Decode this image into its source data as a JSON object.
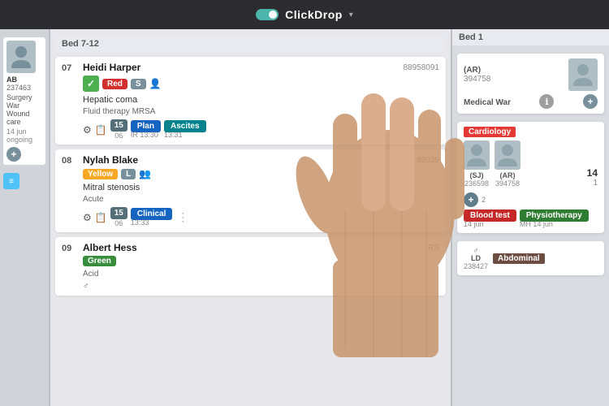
{
  "app": {
    "title": "ClickDrop",
    "dropdown_arrow": "▾"
  },
  "bed_header_main": "Bed 7-12",
  "bed_header_right": "Bed 1",
  "patients": [
    {
      "bed": "07",
      "name": "Heidi Harper",
      "id": "88958091",
      "tag_color": "Red",
      "tag_size": "S",
      "diagnosis": "Hepatic coma",
      "sub_info": "Fluid therapy  MRSA",
      "task1": "Plan",
      "task2": "Ascites",
      "count": "15",
      "count_sub": "06",
      "time1": "IR  13:30",
      "time2": "13:31",
      "has_check": true
    },
    {
      "bed": "08",
      "name": "Nylah Blake",
      "id": "89039",
      "tag_color": "Yellow",
      "tag_size": "L",
      "diagnosis": "Mitral stenosis",
      "sub_info": "Acute",
      "task1": "Clinical",
      "count": "15",
      "count_sub": "06",
      "time1": "13:33",
      "has_check": false
    },
    {
      "bed": "09",
      "name": "Albert Hess",
      "id": "RS",
      "tag_color": "Green",
      "sub_info": "Acid",
      "has_check": false
    }
  ],
  "right_column": {
    "bed_label": "Bed 1",
    "patient1": {
      "initials": "AR",
      "id": "394758"
    },
    "ward1": "Medical War",
    "patient2": {
      "initials": "SJ",
      "id": "236598"
    },
    "patient3": {
      "initials": "AR",
      "id": "394758"
    },
    "ward2": "Cardiology",
    "task_blood": "Blood test",
    "task_blood_date": "14 jun",
    "task_physio": "Physiotherapy",
    "task_physio_date": "MH  14 jun",
    "patient4_initials": "LD",
    "patient4_id": "238427",
    "ward3": "Abdominal"
  },
  "left_partial": {
    "initials": "AB",
    "id": "237463",
    "ward": "Surgery War",
    "sub": "Wound care",
    "time": "14 jun",
    "label": "ongoing"
  },
  "icons": {
    "person": "👤",
    "people": "👥",
    "toggle_on": "●",
    "check": "✓",
    "plus": "+",
    "dots": "⋮",
    "folder": "📁",
    "pill": "💊",
    "drop": "💧"
  }
}
